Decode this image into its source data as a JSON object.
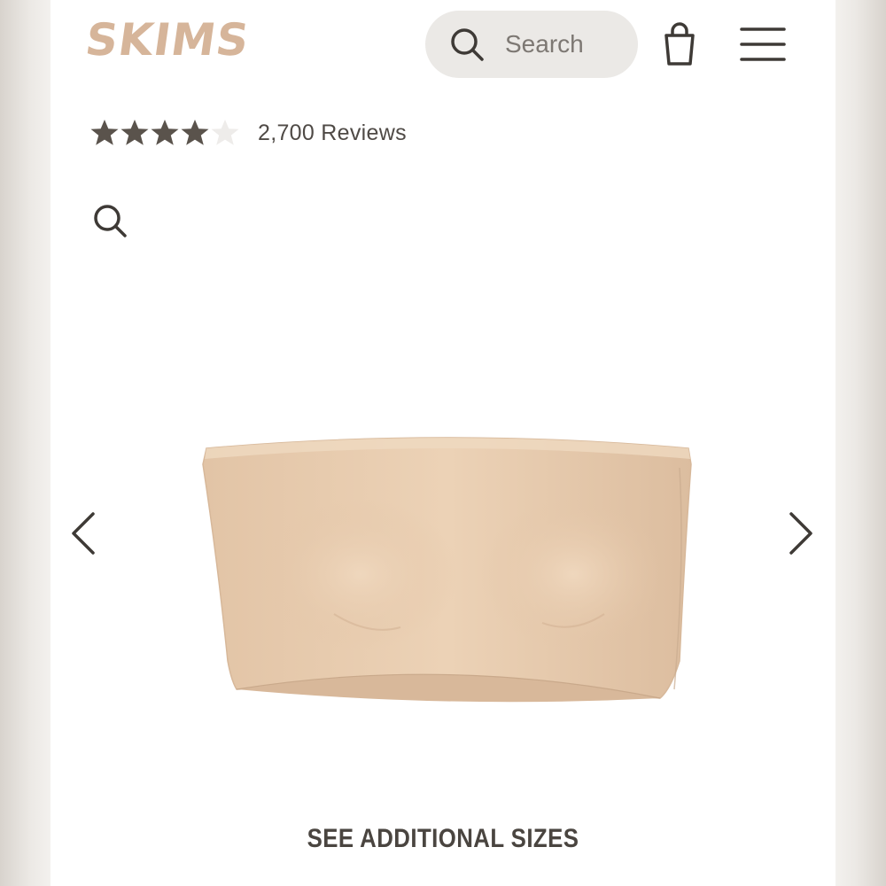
{
  "header": {
    "logo_text": "SKIMS",
    "search": {
      "placeholder": "Search",
      "icon": "search-icon"
    },
    "bag_icon": "shopping-bag-icon",
    "menu_icon": "hamburger-menu-icon"
  },
  "rating": {
    "stars_filled": 4,
    "stars_total": 5,
    "reviews_label": "2,700 Reviews"
  },
  "gallery": {
    "zoom_icon": "zoom-search-icon",
    "prev_icon": "chevron-left-icon",
    "next_icon": "chevron-right-icon",
    "product_image": "strapless-bandeau-top-image"
  },
  "footer": {
    "see_sizes_label": "SEE ADDITIONAL SIZES"
  },
  "colors": {
    "brand": "#d6b59a",
    "text_dark": "#4f4a46",
    "search_bg": "#ebe9e6",
    "product_tone": "#e8cdb0"
  }
}
